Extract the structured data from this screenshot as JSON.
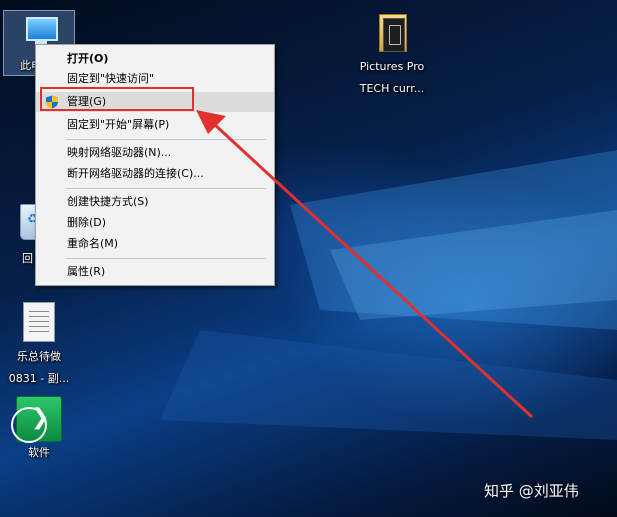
{
  "desktop": {
    "icons": {
      "this_pc": {
        "label": "此电",
        "icon": "this-pc-icon"
      },
      "pictures": {
        "label_line1": "Pictures Pro",
        "label_line2": "TECH curr...",
        "icon": "folder-icon"
      },
      "recycle_bin": {
        "label": "回",
        "icon": "recycle-bin-icon"
      },
      "document": {
        "label_line1": "乐总待做",
        "label_line2": "0831 - 副...",
        "icon": "document-icon"
      },
      "software": {
        "label": "软件",
        "icon": "software-app-icon"
      }
    }
  },
  "context_menu": {
    "items": [
      {
        "label": "打开(O)"
      },
      {
        "label": "固定到\"快速访问\""
      },
      {
        "label": "管理(G)",
        "icon": "uac-shield-icon"
      },
      {
        "label": "固定到\"开始\"屏幕(P)"
      },
      {
        "label": "映射网络驱动器(N)..."
      },
      {
        "label": "断开网络驱动器的连接(C)..."
      },
      {
        "label": "创建快捷方式(S)"
      },
      {
        "label": "删除(D)"
      },
      {
        "label": "重命名(M)"
      },
      {
        "label": "属性(R)"
      }
    ]
  },
  "annotation": {
    "highlight_color": "#e0312d",
    "target": "管理(G)"
  },
  "watermark": {
    "text": "知乎 @刘亚伟"
  }
}
